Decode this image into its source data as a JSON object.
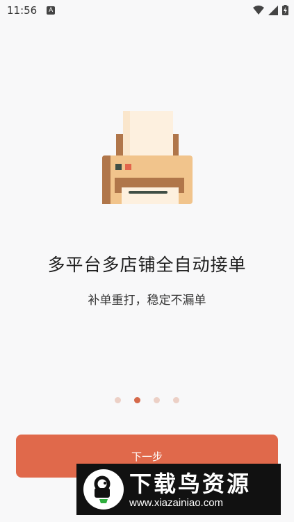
{
  "status_bar": {
    "time": "11:56",
    "app_icon": "A",
    "icons": [
      "wifi-icon",
      "signal-icon",
      "battery-charging-icon"
    ]
  },
  "illustration": {
    "icon": "printer-icon"
  },
  "onboarding": {
    "title": "多平台多店铺全自动接单",
    "subtitle": "补单重打，稳定不漏单",
    "page_index": 2,
    "page_count": 4
  },
  "footer": {
    "next_label": "下一步"
  },
  "watermark": {
    "title": "下载鸟资源",
    "url": "www.xiazainiao.com"
  },
  "colors": {
    "accent": "#e0694b",
    "dot_inactive": "#ecd0c6",
    "background": "#f8f8f9"
  }
}
